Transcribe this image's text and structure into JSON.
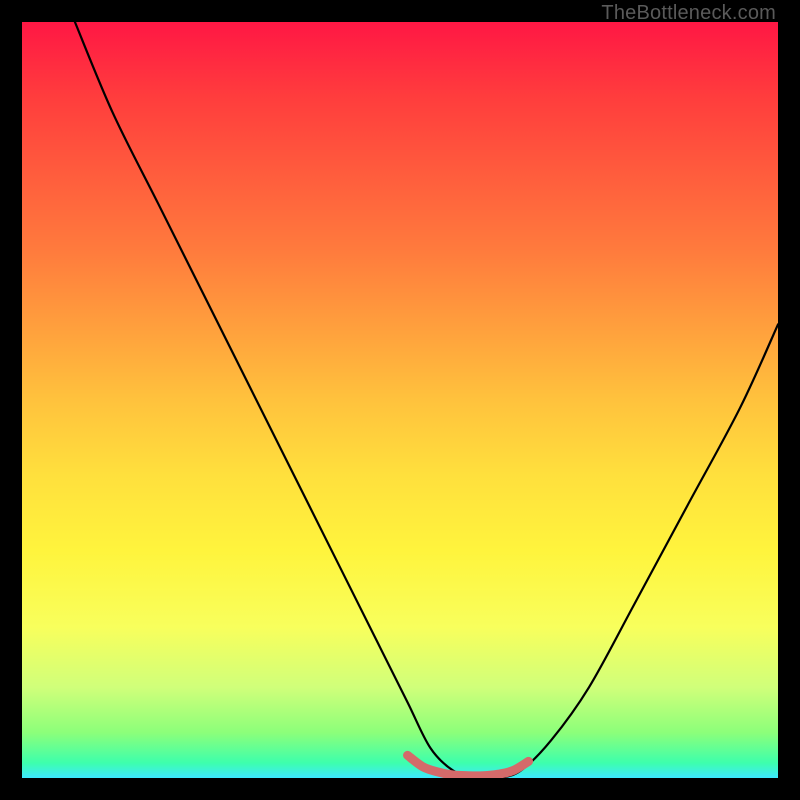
{
  "watermark": "TheBottleneck.com",
  "chart_data": {
    "type": "line",
    "title": "",
    "xlabel": "",
    "ylabel": "",
    "xlim": [
      0,
      100
    ],
    "ylim": [
      0,
      100
    ],
    "grid": false,
    "legend": false,
    "background_gradient": {
      "orientation": "vertical",
      "stops": [
        {
          "pos": 0,
          "color": "#ff1744"
        },
        {
          "pos": 50,
          "color": "#ffc23d"
        },
        {
          "pos": 80,
          "color": "#f8ff5c"
        },
        {
          "pos": 100,
          "color": "#3de8ff"
        }
      ]
    },
    "series": [
      {
        "name": "bottleneck-curve",
        "color": "#000000",
        "stroke_width": 2,
        "x": [
          7,
          12,
          18,
          24,
          30,
          36,
          42,
          47,
          51,
          54,
          57,
          60,
          63,
          66,
          70,
          75,
          81,
          88,
          95,
          100
        ],
        "y": [
          100,
          88,
          76,
          64,
          52,
          40,
          28,
          18,
          10,
          4,
          1,
          0,
          0,
          1,
          5,
          12,
          23,
          36,
          49,
          60
        ]
      },
      {
        "name": "optimal-range-marker",
        "color": "#d46a6a",
        "stroke_width": 9,
        "x": [
          51,
          53,
          55,
          57,
          59,
          61,
          63,
          65,
          67
        ],
        "y": [
          3.0,
          1.5,
          0.8,
          0.4,
          0.3,
          0.3,
          0.5,
          1.0,
          2.2
        ]
      }
    ],
    "annotations": [
      {
        "text": "TheBottleneck.com",
        "role": "watermark",
        "position": "top-right",
        "color": "#5a5a5a"
      }
    ]
  }
}
